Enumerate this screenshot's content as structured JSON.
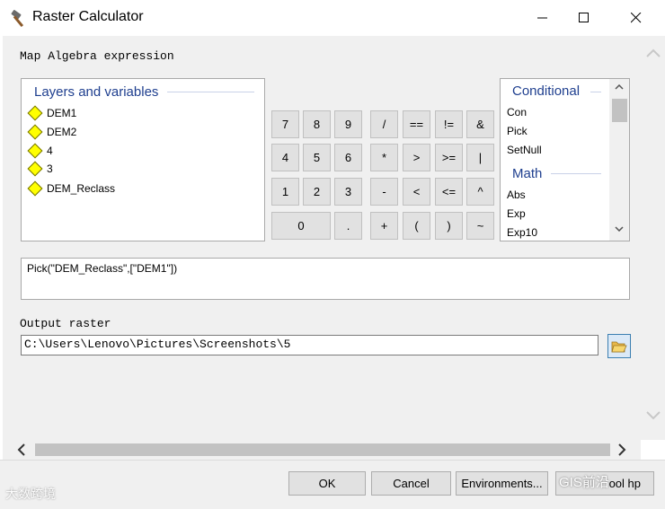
{
  "window": {
    "title": "Raster Calculator",
    "icon": "hammer-icon",
    "controls": {
      "minimize": "minimize-icon",
      "maximize": "maximize-icon",
      "close": "close-icon"
    }
  },
  "labels": {
    "expression": "Map Algebra expression",
    "output": "Output raster"
  },
  "layers": {
    "heading": "Layers and variables",
    "items": [
      "DEM1",
      "DEM2",
      "4",
      "3",
      "DEM_Reclass"
    ]
  },
  "keypad": {
    "keys": [
      "7",
      "8",
      "9",
      "/",
      "==",
      "!=",
      "&",
      "4",
      "5",
      "6",
      "*",
      ">",
      ">=",
      "|",
      "1",
      "2",
      "3",
      "-",
      "<",
      "<=",
      "^",
      "0",
      ".",
      "+",
      "(",
      ")",
      "~"
    ]
  },
  "functions": {
    "conditional_heading": "Conditional",
    "conditional": [
      "Con",
      "Pick",
      "SetNull"
    ],
    "math_heading": "Math",
    "math": [
      "Abs",
      "Exp",
      "Exp10"
    ]
  },
  "expression": {
    "value": "Pick(\"DEM_Reclass\",[\"DEM1\"])"
  },
  "output": {
    "value": "C:\\Users\\Lenovo\\Pictures\\Screenshots\\5",
    "browse_icon": "folder-open-icon"
  },
  "buttons": {
    "ok": "OK",
    "cancel": "Cancel",
    "environments": "Environments...",
    "show_help": "ool hp"
  },
  "watermarks": {
    "left": "大数跨境",
    "right": "GIS前沿"
  }
}
